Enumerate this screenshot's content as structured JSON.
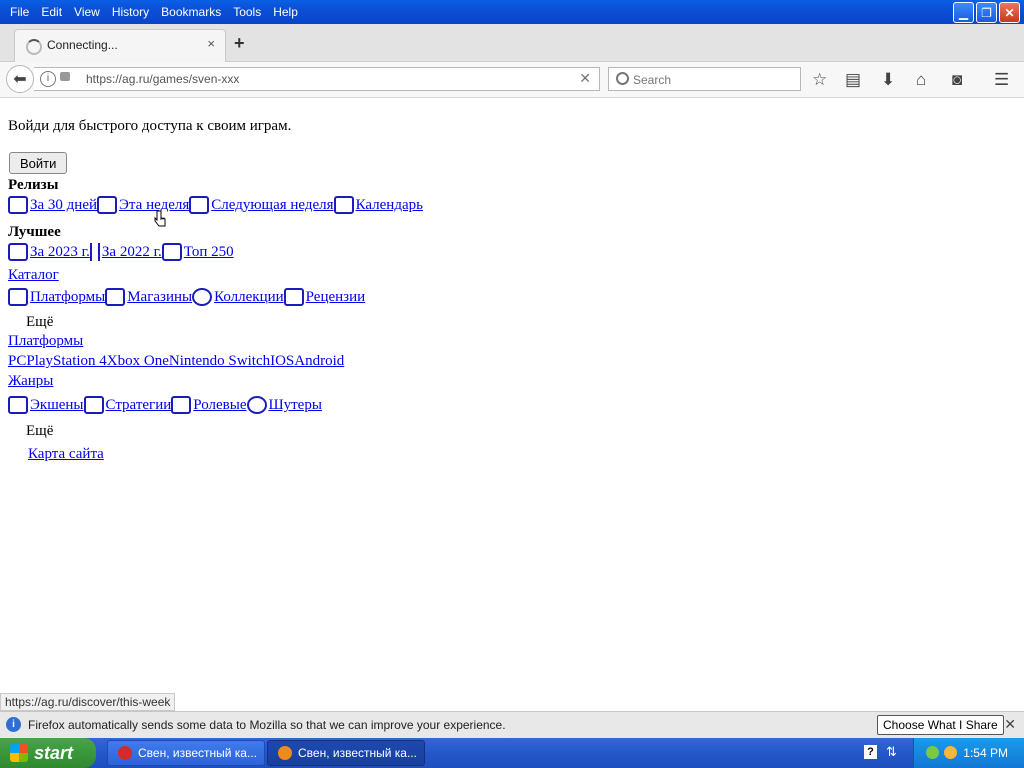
{
  "menu": [
    "File",
    "Edit",
    "View",
    "History",
    "Bookmarks",
    "Tools",
    "Help"
  ],
  "tab": {
    "title": "Connecting...",
    "close": "×",
    "new": "+"
  },
  "nav": {
    "url": "https://ag.ru/games/sven-xxx",
    "search_placeholder": "Search"
  },
  "page": {
    "intro": "Войди для быстрого доступа к своим играм.",
    "login": "Войти",
    "releases": {
      "title": "Релизы",
      "items": [
        "За 30 дней",
        "Эта неделя",
        "Следующая неделя",
        "Календарь"
      ]
    },
    "best": {
      "title": "Лучшее",
      "items": [
        "За 2023 г.",
        "За 2022 г.",
        "Топ 250"
      ]
    },
    "catalog": {
      "title": "Каталог",
      "items": [
        "Платформы",
        "Магазины",
        "Коллекции",
        "Рецензии"
      ],
      "more": "Ещё"
    },
    "platforms": {
      "title": "Платформы",
      "items": [
        "PC",
        "PlayStation 4",
        "Xbox One",
        "Nintendo Switch",
        "IOS",
        "Android"
      ]
    },
    "genres": {
      "title": "Жанры",
      "items": [
        "Экшены",
        "Стратегии",
        "Ролевые",
        "Шутеры"
      ],
      "more": "Ещё"
    },
    "sitemap": "Карта сайта"
  },
  "status_url": "https://ag.ru/discover/this-week",
  "notification": {
    "text": "Firefox automatically sends some data to Mozilla so that we can improve your experience.",
    "button": "Choose What I Share"
  },
  "taskbar": {
    "start": "start",
    "tasks": [
      "Свен, известный ка...",
      "Свен, известный ка..."
    ],
    "clock": "1:54 PM"
  }
}
